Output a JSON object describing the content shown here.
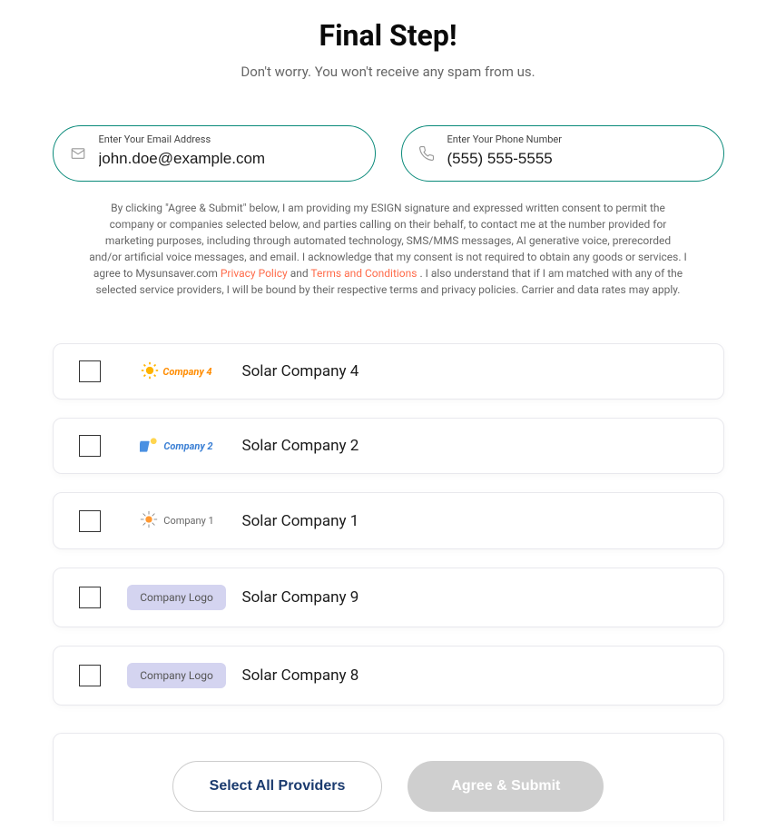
{
  "header": {
    "title": "Final Step!",
    "subtitle": "Don't worry. You won't receive any spam from us."
  },
  "inputs": {
    "email": {
      "label": "Enter Your Email Address",
      "value": "john.doe@example.com"
    },
    "phone": {
      "label": "Enter Your Phone Number",
      "value": "(555) 555-5555"
    }
  },
  "legal": {
    "part1": "By clicking \"Agree & Submit\" below, I am providing my ESIGN signature and expressed written consent to permit the company or companies selected below, and parties calling on their behalf, to contact me at the number provided for marketing purposes, including through automated technology, SMS/MMS messages, AI generative voice, prerecorded and/or artificial voice messages, and email. I acknowledge that my consent is not required to obtain any goods or services. I agree to Mysunsaver.com ",
    "privacy_label": "Privacy Policy",
    "and": " and ",
    "terms_label": "Terms and Conditions",
    "part2": ". I also understand that if I am matched with any of the selected service providers, I will be bound by their respective terms and privacy policies. Carrier and data rates may apply."
  },
  "companies": [
    {
      "name": "Solar Company 4",
      "logo_type": "c4",
      "logo_text": "Company 4"
    },
    {
      "name": "Solar Company 2",
      "logo_type": "c2",
      "logo_text": "Company 2"
    },
    {
      "name": "Solar Company 1",
      "logo_type": "c1",
      "logo_text": "Company 1"
    },
    {
      "name": "Solar Company 9",
      "logo_type": "placeholder",
      "logo_text": "Company Logo"
    },
    {
      "name": "Solar Company 8",
      "logo_type": "placeholder",
      "logo_text": "Company Logo"
    }
  ],
  "actions": {
    "select_all": "Select All Providers",
    "submit": "Agree & Submit"
  }
}
